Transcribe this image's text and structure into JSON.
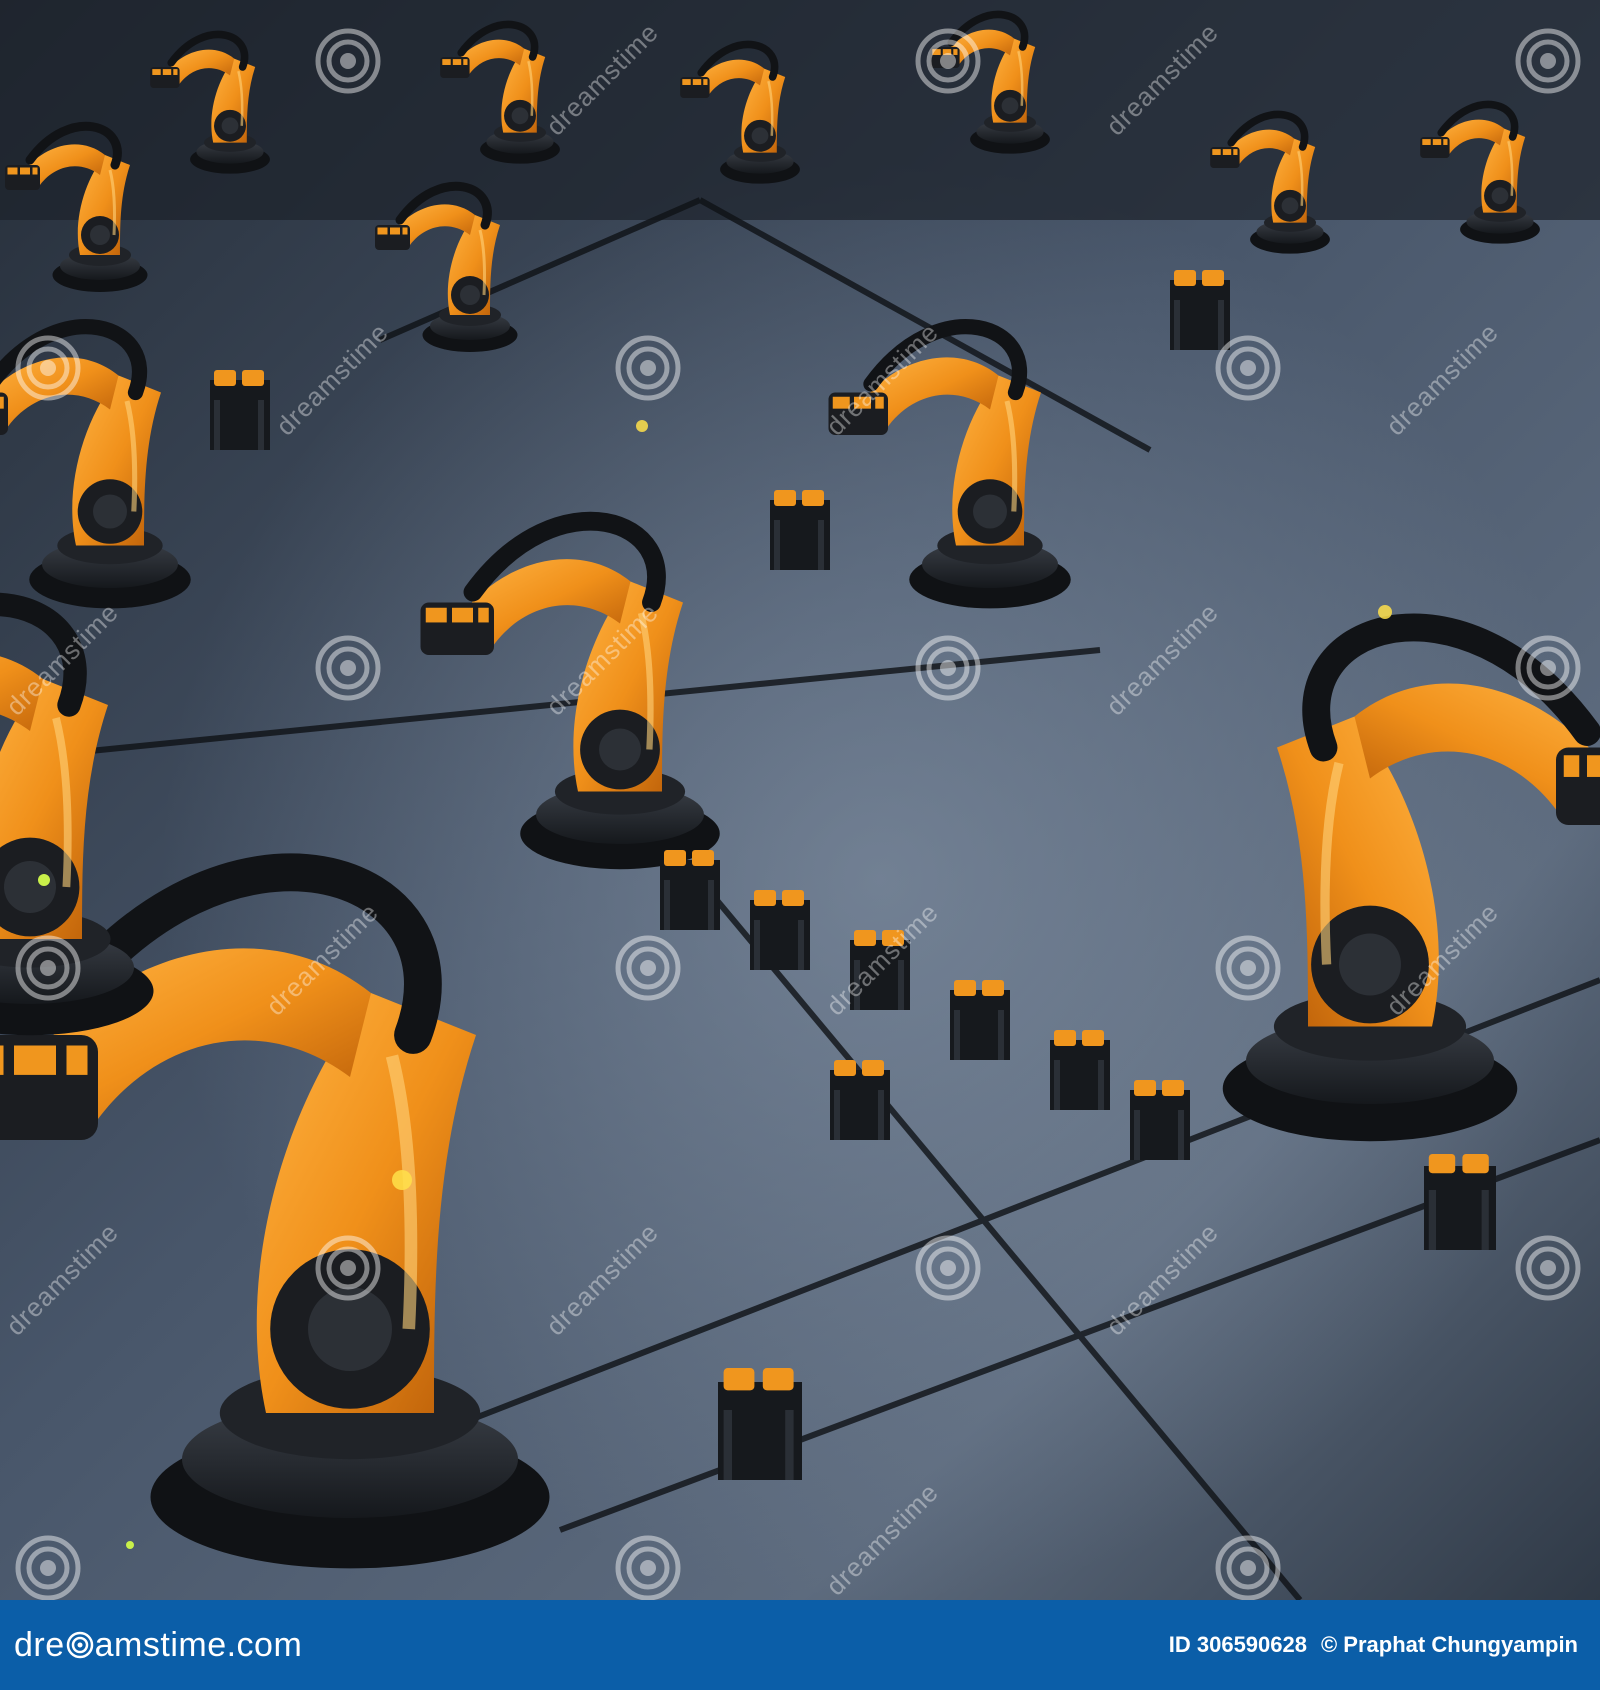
{
  "photo": {
    "subject": "Rows of orange industrial robotic arms on a dark factory floor with assembly stations"
  },
  "watermark": {
    "brand_text": "dreamstime",
    "logo_icon": "spiral-logo-icon"
  },
  "footer": {
    "brand_prefix": "dre",
    "brand_middle": "amstime",
    "brand_suffix": ".com",
    "image_id": "ID 306590628",
    "credit": "© Praphat Chungyampin",
    "colors": {
      "bar": "#0b5ea8",
      "text": "#ffffff"
    }
  },
  "colors": {
    "robot_orange": "#f0961e",
    "robot_dark": "#1b1d21",
    "floor": "#3a4654"
  }
}
